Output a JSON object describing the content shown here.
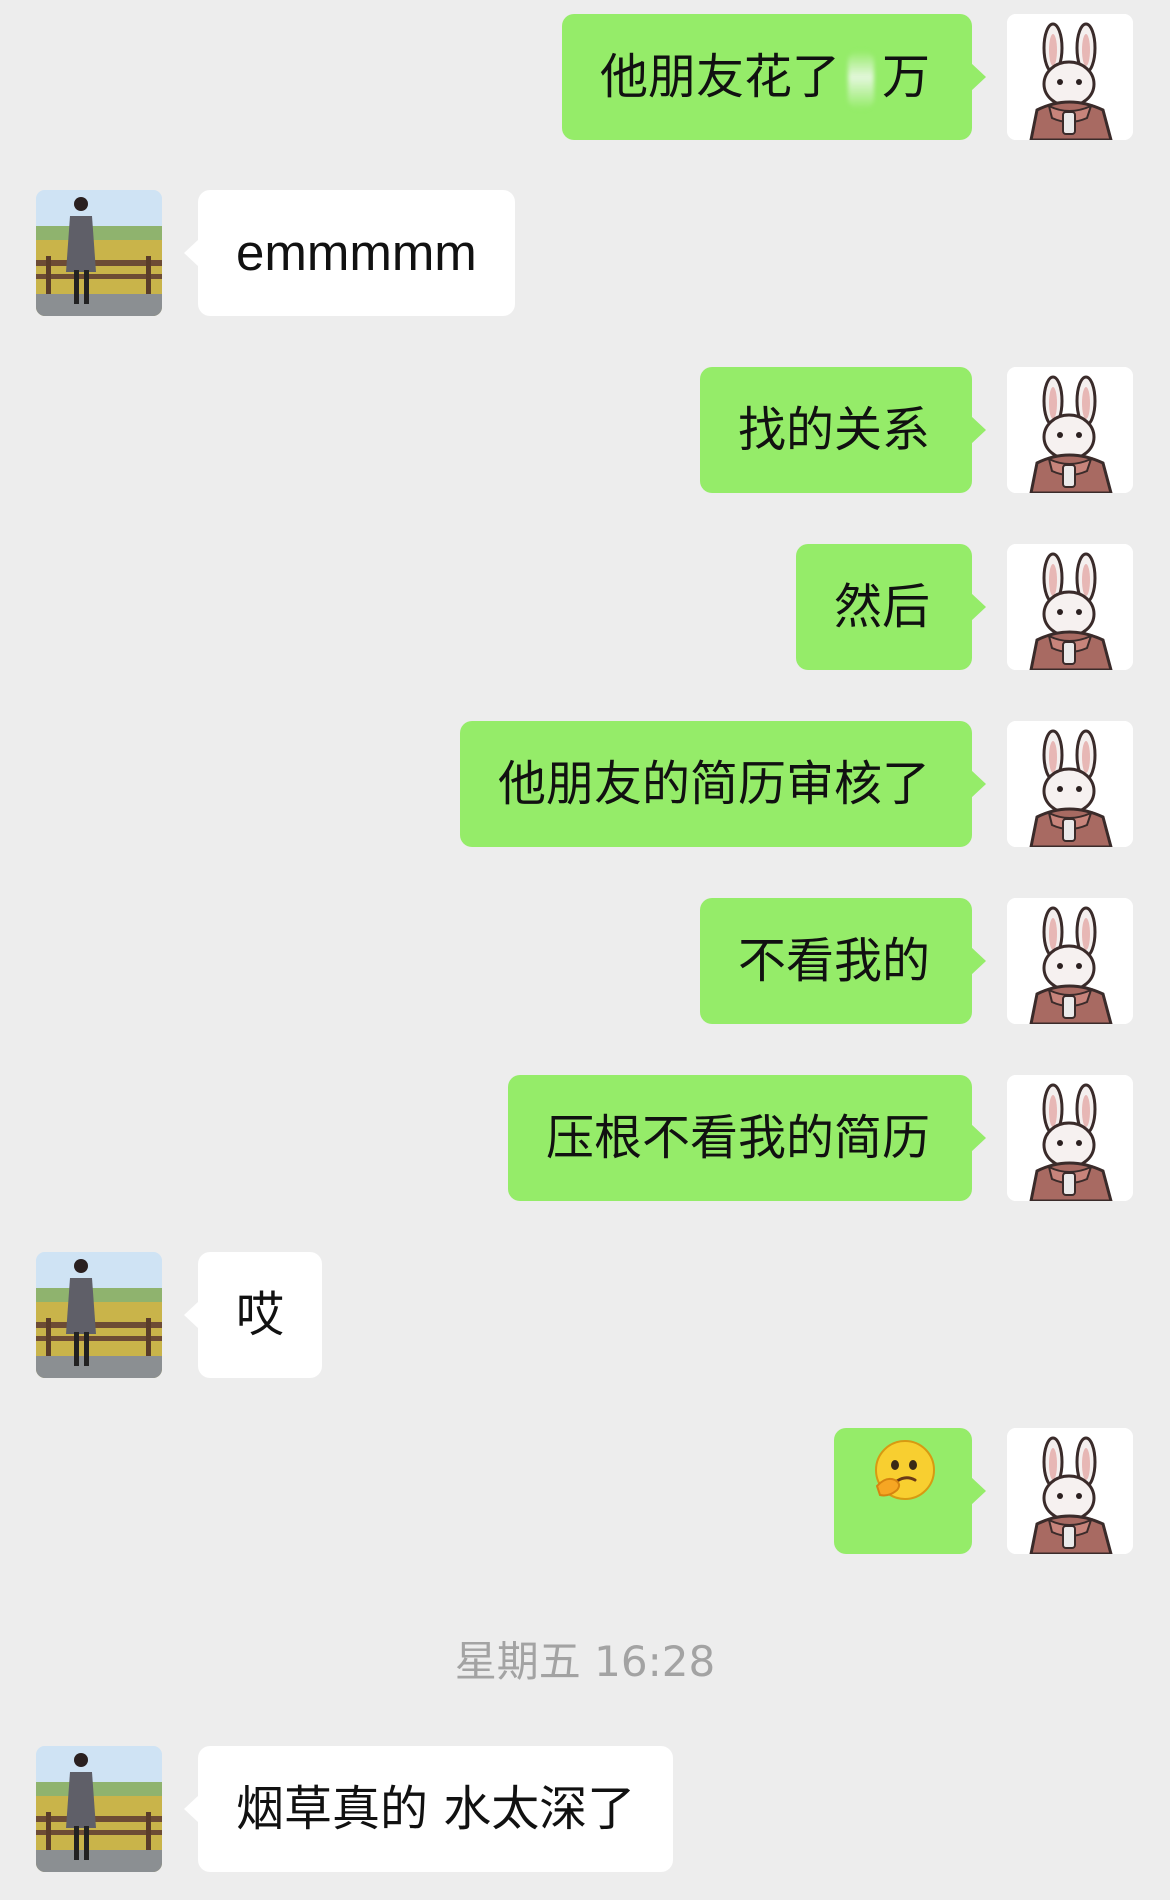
{
  "messages": [
    {
      "sender": "self",
      "avatar": "rabbit-avatar",
      "text_before": "他朋友花了",
      "text_after": "万",
      "redacted": true
    },
    {
      "sender": "other",
      "avatar": "girl-field-avatar",
      "text": "emmmmm"
    },
    {
      "sender": "self",
      "avatar": "rabbit-avatar",
      "text": "找的关系"
    },
    {
      "sender": "self",
      "avatar": "rabbit-avatar",
      "text": "然后"
    },
    {
      "sender": "self",
      "avatar": "rabbit-avatar",
      "text": "他朋友的简历审核了"
    },
    {
      "sender": "self",
      "avatar": "rabbit-avatar",
      "text": "不看我的"
    },
    {
      "sender": "self",
      "avatar": "rabbit-avatar",
      "text": "压根不看我的简历"
    },
    {
      "sender": "other",
      "avatar": "girl-field-avatar",
      "text": "哎"
    },
    {
      "sender": "self",
      "avatar": "rabbit-avatar",
      "emoji": "thinking-face-emoji"
    },
    {
      "sender": "other",
      "avatar": "girl-field-avatar",
      "text": "烟草真的 水太深了"
    }
  ],
  "timestamp": "星期五 16:28",
  "colors": {
    "background": "#ededed",
    "self_bubble": "#95ec69",
    "other_bubble": "#ffffff",
    "timestamp_text": "#a3a3a3"
  }
}
